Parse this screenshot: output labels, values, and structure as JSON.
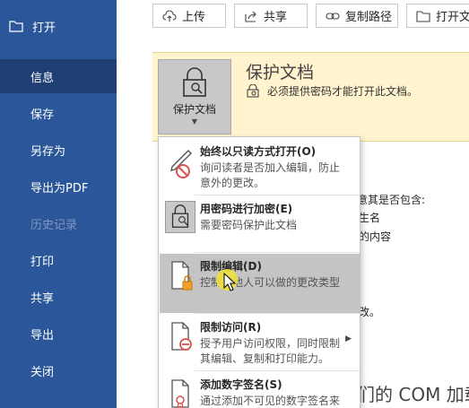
{
  "sidebar": {
    "open_label": "打开",
    "items": [
      {
        "label": "信息",
        "active": true,
        "disabled": false
      },
      {
        "label": "保存",
        "active": false,
        "disabled": false
      },
      {
        "label": "另存为",
        "active": false,
        "disabled": false
      },
      {
        "label": "导出为PDF",
        "active": false,
        "disabled": false
      },
      {
        "label": "历史记录",
        "active": false,
        "disabled": true
      },
      {
        "label": "打印",
        "active": false,
        "disabled": false
      },
      {
        "label": "共享",
        "active": false,
        "disabled": false
      },
      {
        "label": "导出",
        "active": false,
        "disabled": false
      },
      {
        "label": "关闭",
        "active": false,
        "disabled": false
      }
    ]
  },
  "toolbar": {
    "upload": "上传",
    "share": "共享",
    "copy_path": "复制路径",
    "open_location": "打开文"
  },
  "protect": {
    "button_label": "保护文档",
    "title": "保护文档",
    "description": "必须提供密码才能打开此文档。"
  },
  "menu": {
    "items": [
      {
        "title": "始终以只读方式打开(O)",
        "desc": "询问读者是否加入编辑，防止意外的更改。"
      },
      {
        "title": "用密码进行加密(E)",
        "desc": "需要密码保护此文档"
      },
      {
        "title": "限制编辑(D)",
        "desc": "控制其他人可以做的更改类型"
      },
      {
        "title": "限制访问(R)",
        "desc": "授予用户访问权限，同时限制其编辑、复制和打印能力。"
      },
      {
        "title": "添加数字签名(S)",
        "desc": "通过添加不可见的数字签名来"
      }
    ]
  },
  "background": {
    "line1": "意其是否包含:",
    "line2": "生名",
    "line3": "的内容",
    "line4": "改。",
    "heading": "们的 COM 加载"
  }
}
